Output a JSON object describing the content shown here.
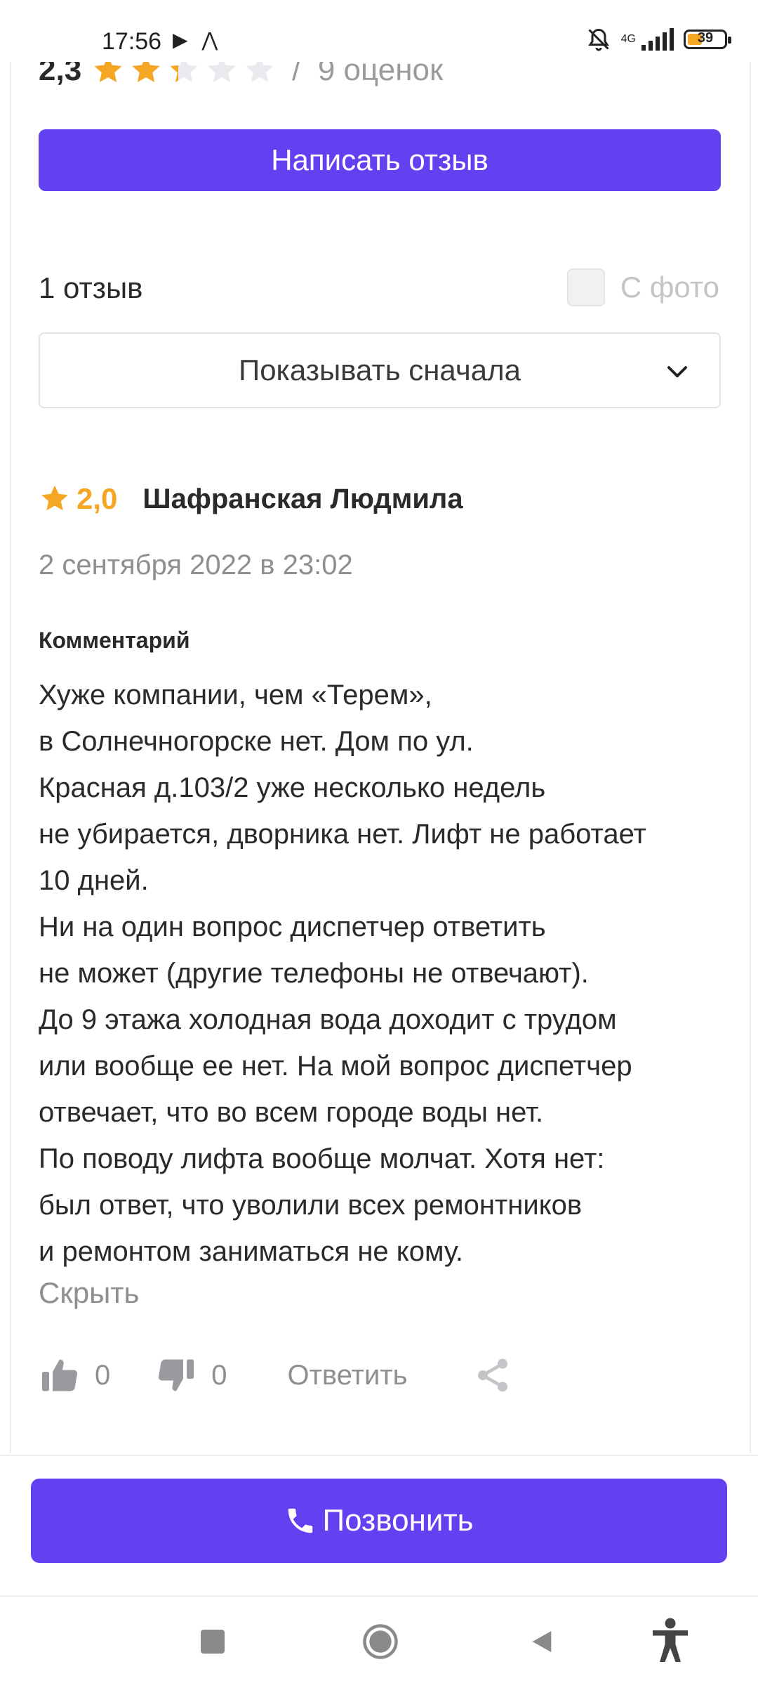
{
  "status_bar": {
    "time": "17:56",
    "left_icons": "▶ ⋀",
    "network": "4G",
    "battery": "39"
  },
  "rating": {
    "value": "2,3",
    "separator": "/",
    "count_label": "9 оценок",
    "stars_filled": 2.3,
    "stars_total": 5,
    "star_color": "#f5a623"
  },
  "write_review_button": "Написать отзыв",
  "reviews": {
    "count_label": "1 отзыв",
    "photo_filter_label": "С фото",
    "photo_filter_checked": false,
    "sort_label": "Показывать сначала"
  },
  "review": {
    "rating": "2,0",
    "author": "Шафранская Людмила",
    "date": "2 сентября 2022 в 23:02",
    "comment_label": "Комментарий",
    "comment_lines": [
      "Хуже компании, чем «Терем»,",
      "в Солнечногорске нет. Дом по ул.",
      "Красная д.103/2 уже несколько недель",
      "не убирается, дворника нет. Лифт не работает",
      "10 дней.",
      "Ни на один вопрос диспетчер ответить",
      "не может (другие телефоны не отвечают).",
      "До 9 этажа холодная вода доходит с трудом",
      "или вообще ее нет. На мой вопрос диспетчер",
      "отвечает, что во всем городе воды нет.",
      "По поводу лифта вообще молчат. Хотя нет:",
      "был ответ, что уволили всех ремонтников",
      "и ремонтом заниматься не кому."
    ],
    "hide_label": "Скрыть",
    "likes": "0",
    "dislikes": "0",
    "reply_label": "Ответить"
  },
  "call_button": "Позвонить",
  "colors": {
    "accent": "#6441f0",
    "star": "#f5a623",
    "muted": "#8e8e93"
  },
  "icons": [
    "bell-off-icon",
    "signal-icon",
    "battery-icon",
    "star-icon",
    "chevron-down-icon",
    "thumbs-up-icon",
    "thumbs-down-icon",
    "share-icon",
    "phone-icon",
    "nav-recents-icon",
    "nav-home-icon",
    "nav-back-icon",
    "accessibility-icon"
  ]
}
